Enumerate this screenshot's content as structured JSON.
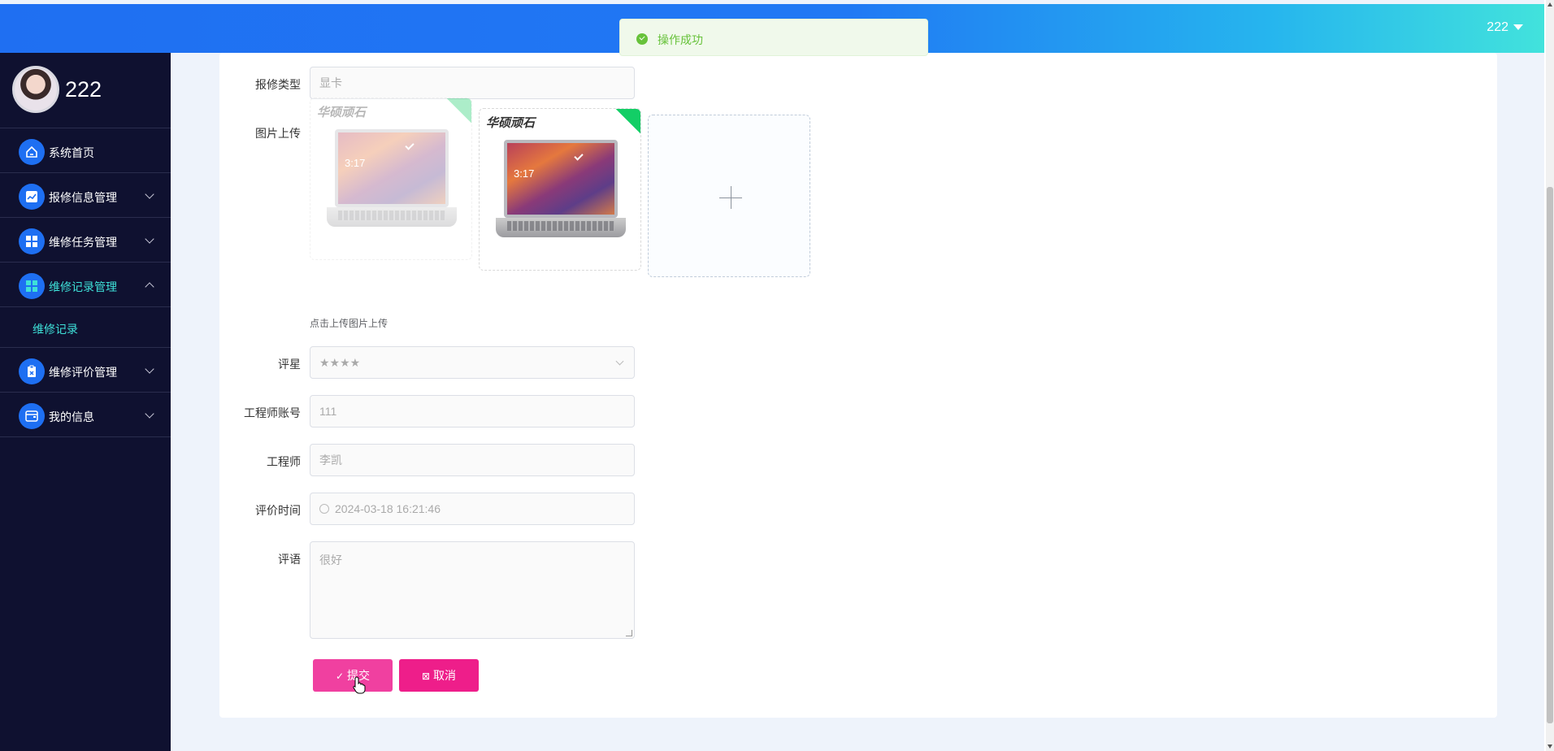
{
  "header": {
    "user_label": "222"
  },
  "toast": {
    "message": "操作成功"
  },
  "sidebar": {
    "username": "222",
    "items": [
      {
        "label": "系统首页",
        "icon": "home-icon"
      },
      {
        "label": "报修信息管理",
        "icon": "chart-icon"
      },
      {
        "label": "维修任务管理",
        "icon": "grid-icon"
      },
      {
        "label": "维修记录管理",
        "icon": "grid-icon",
        "expanded": true
      },
      {
        "label": "维修评价管理",
        "icon": "clipboard-icon"
      },
      {
        "label": "我的信息",
        "icon": "wallet-icon"
      }
    ],
    "submenu": [
      {
        "label": "维修记录"
      }
    ]
  },
  "form": {
    "repair_type": {
      "label": "报修类型",
      "value": "显卡"
    },
    "image_upload": {
      "label": "图片上传",
      "hint": "点击上传图片上传",
      "brand_text": "华硕顽石",
      "screen_time": "3:17"
    },
    "rating": {
      "label": "评星",
      "value": "★★★★"
    },
    "engineer_account": {
      "label": "工程师账号",
      "value": "111"
    },
    "engineer": {
      "label": "工程师",
      "value": "李凯"
    },
    "review_time": {
      "label": "评价时间",
      "value": "2024-03-18 16:21:46"
    },
    "comment": {
      "label": "评语",
      "value": "很好"
    }
  },
  "buttons": {
    "submit": "提交",
    "cancel": "取消"
  },
  "colors": {
    "accent": "#1e6ff2",
    "submit": "#f040a0",
    "cancel": "#ee1e8a",
    "active_menu": "#3ee0d8",
    "sidebar_bg": "#0f1130"
  }
}
